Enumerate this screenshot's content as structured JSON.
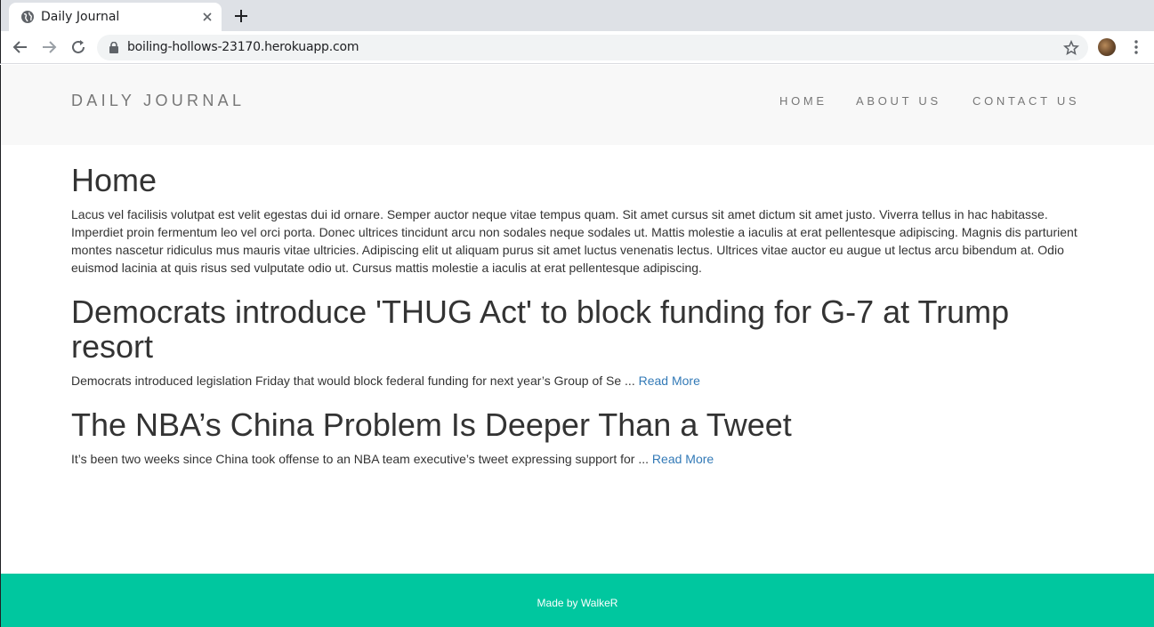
{
  "browser": {
    "tab_title": "Daily Journal",
    "url": "boiling-hollows-23170.herokuapp.com"
  },
  "navbar": {
    "brand": "DAILY JOURNAL",
    "items": [
      {
        "label": "HOME"
      },
      {
        "label": "ABOUT US"
      },
      {
        "label": "CONTACT US"
      }
    ]
  },
  "home": {
    "title": "Home",
    "intro": "Lacus vel facilisis volutpat est velit egestas dui id ornare. Semper auctor neque vitae tempus quam. Sit amet cursus sit amet dictum sit amet justo. Viverra tellus in hac habitasse. Imperdiet proin fermentum leo vel orci porta. Donec ultrices tincidunt arcu non sodales neque sodales ut. Mattis molestie a iaculis at erat pellentesque adipiscing. Magnis dis parturient montes nascetur ridiculus mus mauris vitae ultricies. Adipiscing elit ut aliquam purus sit amet luctus venenatis lectus. Ultrices vitae auctor eu augue ut lectus arcu bibendum at. Odio euismod lacinia at quis risus sed vulputate odio ut. Cursus mattis molestie a iaculis at erat pellentesque adipiscing."
  },
  "posts": [
    {
      "title": "Democrats introduce 'THUG Act' to block funding for G-7 at Trump resort",
      "excerpt": "Democrats introduced legislation Friday that would block federal funding for next year’s Group of Se ...",
      "read_more": "Read More"
    },
    {
      "title": "The NBA’s China Problem Is Deeper Than a Tweet",
      "excerpt": "It’s been two weeks since China took offense to an NBA team executive’s tweet expressing support for ...",
      "read_more": "Read More"
    }
  ],
  "footer": {
    "text": "Made by WalkeR"
  },
  "colors": {
    "footer_bg": "#00c79f",
    "navbar_bg": "#f8f8f8",
    "link": "#337ab7"
  }
}
